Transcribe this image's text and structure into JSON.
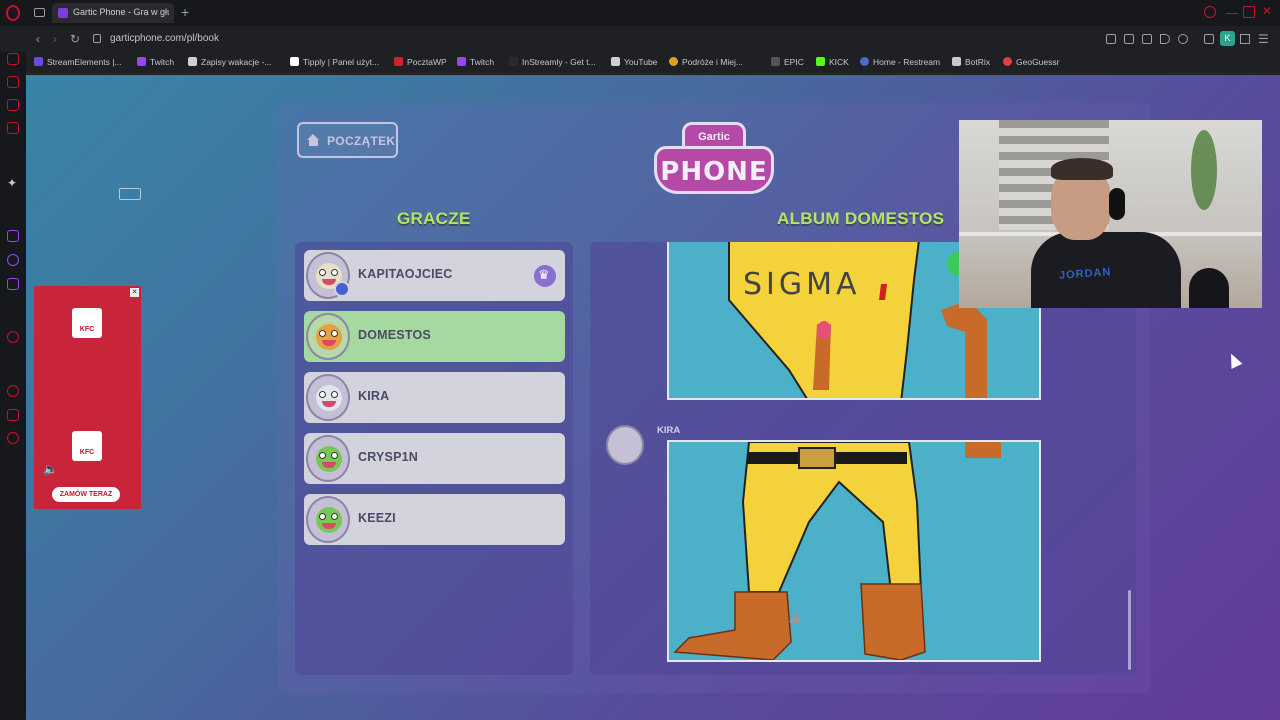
{
  "browser": {
    "tab_title": "Gartic Phone - Gra w głuc",
    "url": "garticphone.com/pl/book",
    "profile_initial": "K"
  },
  "bookmarks": [
    "StreamElements |...",
    "Twitch",
    "Zapisy wakacje -...",
    "Tipply | Panel użyt...",
    "PocztaWP",
    "Twitch",
    "InStreamly - Get t...",
    "YouTube",
    "Podróże i Miej...",
    "EPIC",
    "KICK",
    "Home - Restream",
    "BotRix",
    "GeoGuessr"
  ],
  "game": {
    "home_label": "POCZĄTEK",
    "logo_top": "Gartic",
    "logo_main": "PHONE",
    "players_title": "GRACZE",
    "album_title": "ALBUM DOMESTOS",
    "players": [
      {
        "name": "KAPITAOJCIEC",
        "host": true
      },
      {
        "name": "DOMESTOS",
        "active": true
      },
      {
        "name": "KIRA"
      },
      {
        "name": "CRYSP1N"
      },
      {
        "name": "KEEZI"
      }
    ],
    "drawing_text": "SIGMA",
    "author": "KIRA"
  },
  "ad": {
    "brand": "KFC",
    "cta": "ZAMÓW TERAZ"
  },
  "webcam": {
    "shirt_text": "JORDAN"
  },
  "colors": {
    "accent_green": "#b6e26a",
    "active_row": "#a6d9a0",
    "logo_purple": "#b54aa6",
    "kfc_red": "#c8253a"
  }
}
